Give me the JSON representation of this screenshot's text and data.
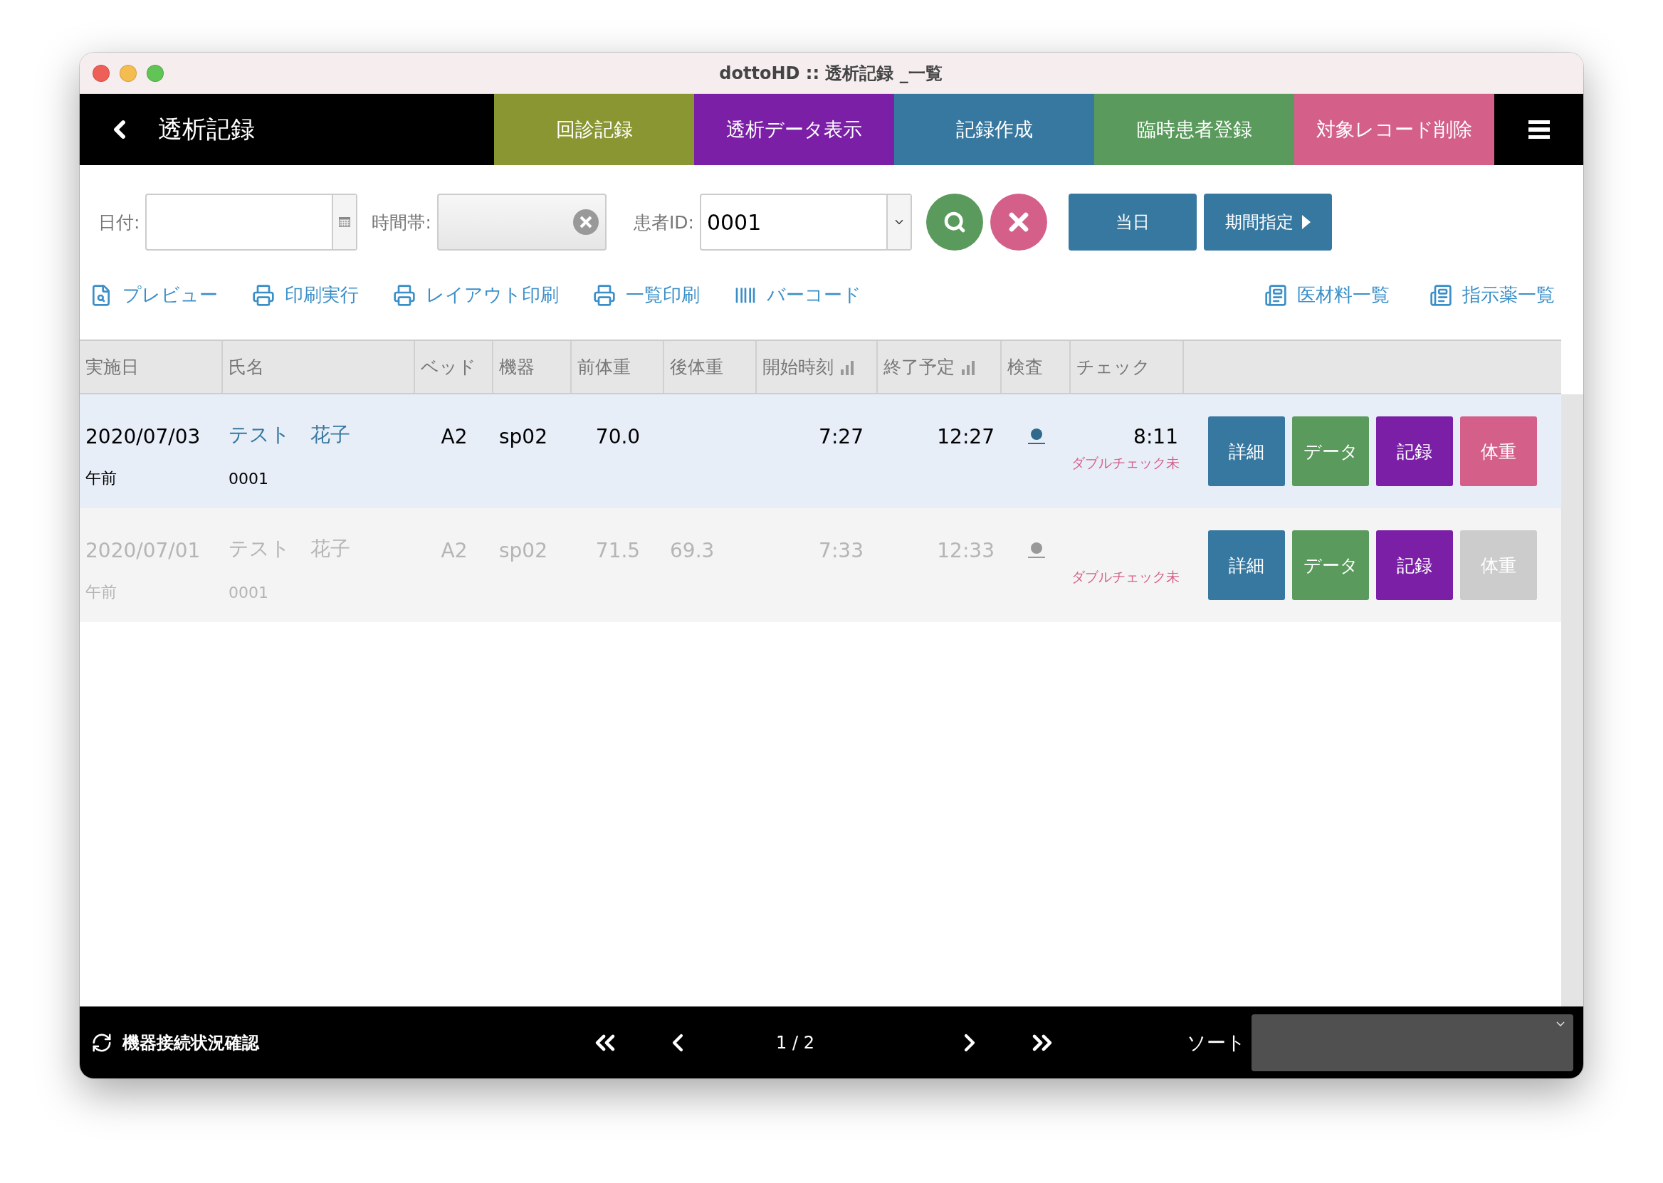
{
  "window": {
    "title": "dottoHD :: 透析記録 _一覧"
  },
  "header": {
    "title": "透析記録",
    "nav": [
      {
        "label": "回診記録",
        "color": "#8a9632"
      },
      {
        "label": "透析データ表示",
        "color": "#7a1fa6"
      },
      {
        "label": "記録作成",
        "color": "#3778a0"
      },
      {
        "label": "臨時患者登録",
        "color": "#5a9a5c"
      },
      {
        "label": "対象レコード削除",
        "color": "#d4608a"
      }
    ]
  },
  "filters": {
    "date": {
      "label": "日付:"
    },
    "time_slot": {
      "label": "時間帯:"
    },
    "patient_id": {
      "label": "患者ID:",
      "value": "0001"
    },
    "today_button": "当日",
    "period_button": "期間指定"
  },
  "toolbar": {
    "left": [
      {
        "label": "プレビュー",
        "kind": "preview"
      },
      {
        "label": "印刷実行",
        "kind": "print"
      },
      {
        "label": "レイアウト印刷",
        "kind": "print"
      },
      {
        "label": "一覧印刷",
        "kind": "print"
      },
      {
        "label": "バーコード",
        "kind": "barcode"
      }
    ],
    "right": [
      {
        "label": "医材料一覧",
        "kind": "list"
      },
      {
        "label": "指示薬一覧",
        "kind": "list"
      }
    ]
  },
  "table": {
    "columns": [
      {
        "label": "実施日",
        "sort_icon": false
      },
      {
        "label": "氏名",
        "sort_icon": false
      },
      {
        "label": "ベッド",
        "sort_icon": false
      },
      {
        "label": "機器",
        "sort_icon": false
      },
      {
        "label": "前体重",
        "sort_icon": false
      },
      {
        "label": "後体重",
        "sort_icon": false
      },
      {
        "label": "開始時刻",
        "sort_icon": true
      },
      {
        "label": "終了予定",
        "sort_icon": true
      },
      {
        "label": "検査",
        "sort_icon": false
      },
      {
        "label": "チェック",
        "sort_icon": false
      }
    ],
    "rows": [
      {
        "selected": true,
        "disabled": false,
        "date": "2020/07/03",
        "period": "午前",
        "name": "テスト　花子",
        "patient_id": "0001",
        "bed": "A2",
        "device": "sp02",
        "pre_weight": "70.0",
        "start": "7:27",
        "end": "12:27",
        "check_time": "8:11",
        "check_note": "ダブルチェック未",
        "actions": [
          {
            "label": "詳細",
            "color": "#3778a0"
          },
          {
            "label": "データ",
            "color": "#5a9a5c"
          },
          {
            "label": "記録",
            "color": "#7a1fa6"
          },
          {
            "label": "体重",
            "color": "#d4608a"
          }
        ]
      },
      {
        "selected": false,
        "disabled": true,
        "date": "2020/07/01",
        "period": "午前",
        "name": "テスト　花子",
        "patient_id": "0001",
        "bed": "A2",
        "device": "sp02",
        "pre_weight": "71.5",
        "post_weight": "69.3",
        "start": "7:33",
        "end": "12:33",
        "check_note": "ダブルチェック未",
        "actions": [
          {
            "label": "詳細",
            "color": "#3778a0"
          },
          {
            "label": "データ",
            "color": "#5a9a5c"
          },
          {
            "label": "記録",
            "color": "#7a1fa6"
          },
          {
            "label": "体重",
            "color": "#cccccc"
          }
        ]
      }
    ]
  },
  "footer": {
    "status_link": "機器接続状況確認",
    "page": "1 / 2",
    "sort_label": "ソート"
  }
}
